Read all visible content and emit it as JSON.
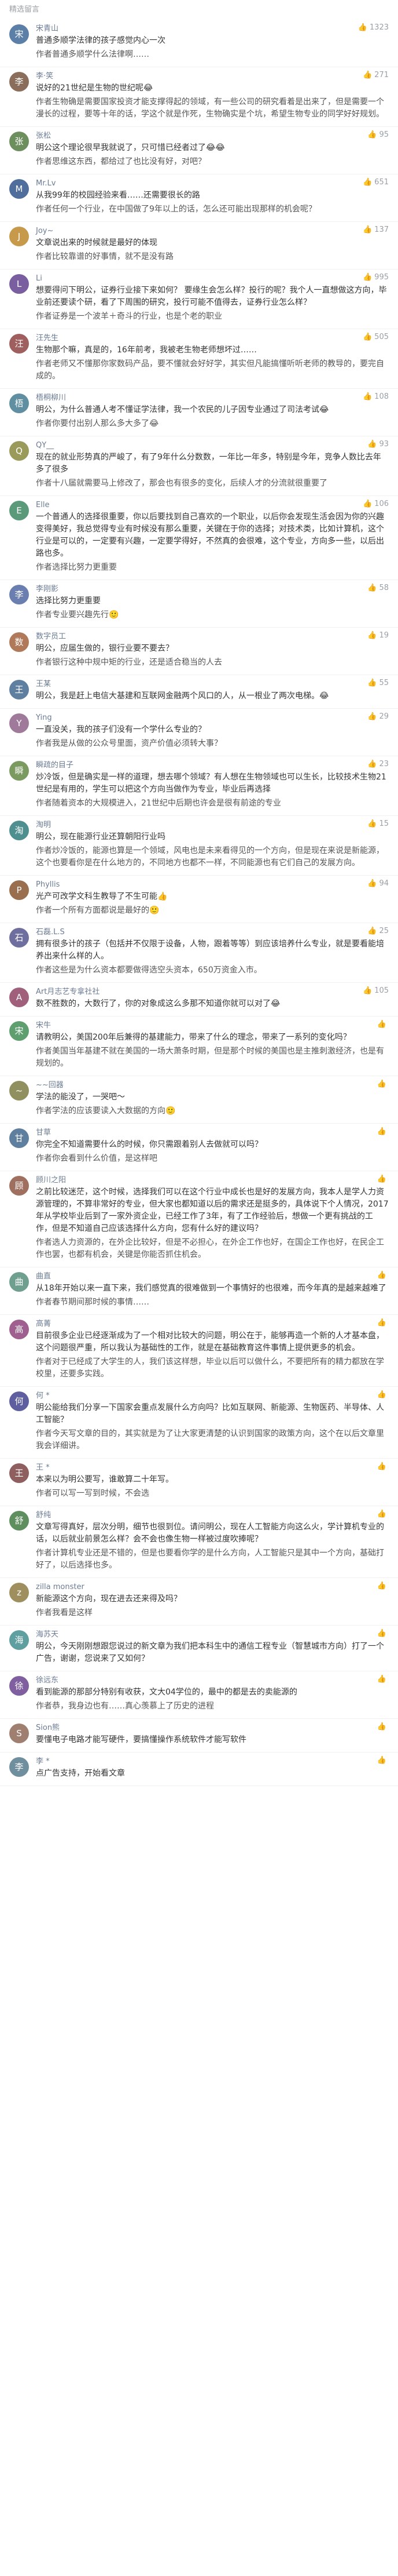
{
  "header": {
    "title": "精选留言"
  },
  "comments": [
    {
      "user": "宋青山",
      "likes": "1323",
      "avatar": "#5b7fa6",
      "label": "作者",
      "reply": "普通多顺学法律的孩子感觉内心一次",
      "body": "普通多顺学什么法律啊……"
    },
    {
      "user": "李·笑",
      "likes": "271",
      "avatar": "#8a6d5a",
      "label": "作者",
      "reply": "说好的21世纪是生物的世纪呢😂",
      "body": "生物确是需要国家投资才能支撑得起的领域，有一些公司的研究看着是出来了，但是需要一个漫长的过程，要等十年的话，学这个就是作死，生物确实是个坑，希望生物专业的同学好好规划。"
    },
    {
      "user": "张松",
      "likes": "95",
      "avatar": "#6d8f5e",
      "label": "作者",
      "reply": "明公这个理论很早我就说了，只可惜已经者过了😂😂",
      "body": "思维这东西，都给过了也比没有好，对吧？"
    },
    {
      "user": "Mr.Lv",
      "likes": "651",
      "avatar": "#4f6e9c",
      "label": "作者",
      "reply": "从我99年的校园经验来看……还需要很长的路",
      "body": "任何一个行业，在中国做了9年以上的话，怎么还可能出现那样的机会呢？"
    },
    {
      "user": "Joy~",
      "likes": "137",
      "avatar": "#c79a4b",
      "label": "作者",
      "reply": "文章说出来的时候就是最好的体现",
      "body": "比较靠谱的好事情，就不是没有路"
    },
    {
      "user": "Li",
      "likes": "995",
      "avatar": "#7a5fa0",
      "label": "作者",
      "reply": "想要得问下明公，证券行业接下来如何？ 要缘生会怎么样？投行的呢？我个人一直想做这方向，毕业前还要读个研，看了下周围的研究，投行可能不值得去，证券行业怎么样？",
      "body": "证券是一个波羊＋奇斗的行业，也是个老的职业"
    },
    {
      "user": "汪先生",
      "likes": "505",
      "avatar": "#a05f5f",
      "label": "作者",
      "reply": "生物那个嘛，真是的，16年前考，我被老生物老师想坏过……",
      "body": "老师又不懂那你家数码产品，要不懂就会好好学，其实但凡能搞懂听听老师的教导的，要完自成的。"
    },
    {
      "user": "梧桐柳川",
      "likes": "108",
      "avatar": "#5f8fa0",
      "label": "作者",
      "reply": "明公，为什么普通人考不懂证学法律，我一个农民的儿子因专业通过了司法考试😂",
      "body": "你要付出别人那么多大多了😂"
    },
    {
      "user": "QY__",
      "likes": "93",
      "avatar": "#9a9a5a",
      "label": "作者",
      "reply": "现在的就业形势真的严峻了，有了9年什么分数数，一年比一年多，特别是今年，竞争人数比去年多了很多",
      "body": "十八届就需要马上修改了，那会也有很多的变化，后续人才的分流就很重要了"
    },
    {
      "user": "Elle",
      "likes": "106",
      "avatar": "#5a9a7a",
      "label": "作者",
      "reply": "一个普通人的选择很重要，你以后要找到自己喜欢的一个职业，以后你会发现生活会因为你的兴趣变得美好，我总觉得专业有时候没有那么重要，关键在于你的选择；对技术类，比如计算机，这个行业是可以的，一定要有兴趣，一定要学得好，不然真的会很难，这个专业，方向多一些，以后出路也多。",
      "body": "选择比努力更重要"
    },
    {
      "user": "李刚影",
      "likes": "58",
      "avatar": "#6a7fb0",
      "label": "作者",
      "reply": "选择比努力更重要",
      "body": "专业要兴趣先行🙂"
    },
    {
      "user": "数字员工",
      "likes": "19",
      "avatar": "#b07a5a",
      "label": "作者",
      "reply": "明公，应届生做的，银行业要不要去？",
      "body": "银行这种中规中矩的行业，还是适合稳当的人去"
    },
    {
      "user": "王某",
      "likes": "55",
      "avatar": "#5f7fa0",
      "label": "作者",
      "reply": "明公，我是赶上电信大基建和互联网金融两个风口的人，从一根业了两次电梯。😂",
      "body": ""
    },
    {
      "user": "Ying",
      "likes": "29",
      "avatar": "#a07a9a",
      "label": "作者",
      "reply": "一直没关，我的孩子们没有一个学什么专业的？",
      "body": "我是从做的公众号里面，资产价值必须转大事？"
    },
    {
      "user": "瞬疏的目子",
      "likes": "23",
      "avatar": "#7a9a5f",
      "label": "作者",
      "reply": "炒冷饭，但是确实是一样的道理，想去哪个领域？有人想在生物领域也可以生长，比较技术生物21世纪是有用的，学生可以把这个方向当做作为专业，毕业后再选择",
      "body": "随着资本的大规模进入，21世纪中后期也许会是很有前途的专业"
    },
    {
      "user": "淘明",
      "likes": "15",
      "avatar": "#4f8f8f",
      "label": "作者",
      "reply": "明公，现在能源行业还算朝阳行业吗",
      "body": "炒冷饭的，能源也算是一个领域，风电也是未来看得见的一个方向，但是现在来说是新能源，这个也要看你是在什么地方的，不同地方也都不一样，不同能源也有它们自己的发展方向。"
    },
    {
      "user": "Phyllis",
      "likes": "94",
      "avatar": "#9a6f4f",
      "label": "作者",
      "reply": "光产可改学文科生教导了不生可能👍",
      "body": "一个所有方面都说是最好的🙂"
    },
    {
      "user": "石磊.L.S",
      "likes": "25",
      "avatar": "#6f6f9f",
      "label": "作者",
      "reply": "拥有很多计的孩子（包括并不仅限于设备，人物，跟着等等）到应该培养什么专业，就是要看能培养出来什么样的人。",
      "body": "这些是为什么资本都要做得选空头资本，650万资金入市。"
    },
    {
      "user": "Art月志艺专拿社社",
      "likes": "105",
      "avatar": "#a05f7a",
      "label": "作者",
      "reply": "数不胜数的，大数行了，你的对象成这么多那不知道你就可以对了😂",
      "body": ""
    },
    {
      "user": "宋牛",
      "likes": "",
      "avatar": "#5f9f6f",
      "label": "作者",
      "reply": "请教明公，美国200年后兼得的基建能力，带来了什么的理念，带来了一系列的变化吗？",
      "body": "美国当年基建不就在美国的一场大萧条时期，但是那个时候的美国也是主推刺激经济，也是有规划的。"
    },
    {
      "user": "~~回器",
      "likes": "",
      "avatar": "#8f8f5f",
      "label": "作者",
      "reply": "学法的能没了，一哭吧～",
      "body": "学法的应该要读入大数据的方向🙂"
    },
    {
      "user": "甘草",
      "likes": "",
      "avatar": "#5f7f9f",
      "label": "作者",
      "reply": "你完全不知道需要什么的时候，你只需跟着别人去做就可以吗？",
      "body": "你会看到什么价值，是这样吧"
    },
    {
      "user": "顾川之阳",
      "likes": "",
      "avatar": "#9f6f5f",
      "label": "作者",
      "reply": "之前比较迷茫，这个时候，选择我们可以在这个行业中成长也是好的发展方向，我本人是学人力资源管理的，不算非常好的专业，但大家也都知道以后的需求还是挺多的，具体说下个人情况，2017年从学校毕业后到了一家外资企业，已经工作了3年，有了工作经验后，想做一个更有挑战的工作，但是不知道自己应该选择什么方向，您有什么好的建议吗？",
      "body": "选人力资源的，在外企比较好，但是不必担心，在外企工作也好，在国企工作也好，在民企工作也罢，也都有机会，关键是你能否抓住机会。"
    },
    {
      "user": "曲直",
      "likes": "",
      "avatar": "#6f9f8f",
      "label": "作者",
      "reply": "从18年开始以来一直下来，我们感觉真的很难做到一个事情好的也很难，而今年真的是越来越难了",
      "body": "春节期间那时候的事情……"
    },
    {
      "user": "高菁",
      "likes": "",
      "avatar": "#9f5f8f",
      "label": "作者",
      "reply": "目前很多企业已经逐渐成为了一个相对比较大的问题，明公在于，能够再造一个新的人才基本盘，这个问题很严重，所以我认为基础性的工作，就是在基础教育这件事情上提供更多的机会。",
      "body": "对于已经成了大学生的人，我们该这样想，毕业以后可以做什么，不要把所有的精力都放在学校里，还要多实践。"
    },
    {
      "user": "何 *",
      "likes": "",
      "avatar": "#5f5f9f",
      "label": "作者",
      "reply": "明公能给我们分享一下国家会重点发展什么方向吗？比如互联网、新能源、生物医药、半导体、人工智能？",
      "body": "今天写文章的目的，其实就是为了让大家更清楚的认识到国家的政策方向，这个在以后文章里我会详细讲。"
    },
    {
      "user": "王 *",
      "likes": "",
      "avatar": "#8f5f5f",
      "label": "作者",
      "reply": "本来以为明公要写，谁敢算二十年写。",
      "body": "可以写一写到时候，不会选"
    },
    {
      "user": "舒纯",
      "likes": "",
      "avatar": "#5f8f5f",
      "label": "作者",
      "reply": "文章写得真好，层次分明，细节也很到位。请问明公，现在人工智能方向这么火，学计算机专业的话，以后就业前景怎么样？会不会也像生物一样被过度吹捧呢？",
      "body": "计算机专业还是不错的，但是也要看你学的是什么方向，人工智能只是其中一个方向，基础打好了，以后选择也多。"
    },
    {
      "user": "zilla monster",
      "likes": "",
      "avatar": "#9f8f5f",
      "label": "作者",
      "reply": "新能源这个方向，现在进去还来得及吗？",
      "body": "我看是这样"
    },
    {
      "user": "海苏天",
      "likes": "",
      "avatar": "#5f9f9f",
      "label": "作者",
      "reply": "明公，今天刚刚想跟您说过的新文章为我们把本科生中的通信工程专业（智慧城市方向）打了一个广告，谢谢，您说来了又如何？",
      "body": ""
    },
    {
      "user": "徐远东",
      "likes": "",
      "avatar": "#7f5f9f",
      "label": "作者",
      "reply": "看到能源的那部分特别有收获，文大04学位的，最中的都是去的卖能源的",
      "body": "恭，我身边也有……真心羡慕上了历史的进程"
    },
    {
      "user": "Sion熊",
      "likes": "",
      "avatar": "#9f7f6f",
      "label": "作者",
      "reply": "要懂电子电路才能写硬件，要搞懂操作系统软件才能写软件",
      "body": ""
    },
    {
      "user": "李 *",
      "likes": "",
      "avatar": "#6f8f9f",
      "label": "作者",
      "reply": "点广告支持，开始看文章",
      "body": ""
    }
  ]
}
